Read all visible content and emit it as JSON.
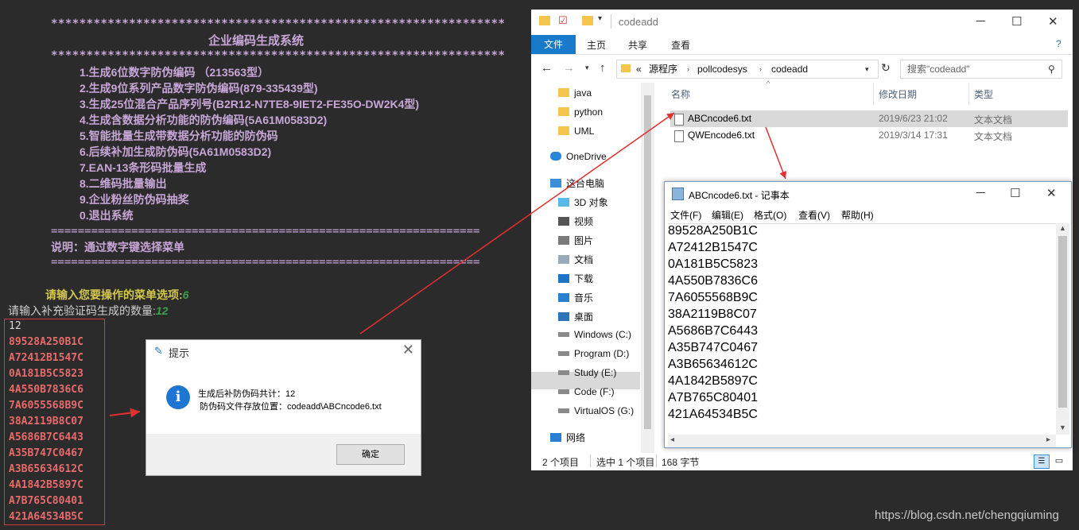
{
  "console": {
    "stars": "****************************************************************",
    "title": "企业编码生成系统",
    "menu": [
      "1.生成6位数字防伪编码 （213563型）",
      "2.生成9位系列产品数字防伪编码(879-335439型)",
      "3.生成25位混合产品序列号(B2R12-N7TE8-9IET2-FE35O-DW2K4型)",
      "4.生成含数据分析功能的防伪编码(5A61M0583D2)",
      "5.智能批量生成带数据分析功能的防伪码",
      "6.后续补加生成防伪码(5A61M0583D2)",
      "7.EAN-13条形码批量生成",
      "8.二维码批量输出",
      "9.企业粉丝防伪码抽奖",
      "0.退出系统"
    ],
    "equals": "================================================================",
    "note": "说明：通过数字键选择菜单",
    "prompt_label": "请输入您要操作的菜单选项:",
    "prompt_value": "6",
    "count_label": "请输入补充验证码生成的数量:",
    "count_value": "12",
    "output_first": "12",
    "codes": [
      "89528A250B1C",
      "A72412B1547C",
      "0A181B5C5823",
      "4A550B7836C6",
      "7A6055568B9C",
      "38A2119B8C07",
      "A5686B7C6443",
      "A35B747C0467",
      "A3B65634612C",
      "4A1842B5897C",
      "A7B765C80401",
      "421A64534B5C"
    ]
  },
  "dialog": {
    "title": "提示",
    "line1": "生成后补防伪码共计：12",
    "line2": "防伪码文件存放位置：codeadd\\ABCncode6.txt",
    "ok": "确定"
  },
  "explorer": {
    "title": "codeadd",
    "tabs": [
      "文件",
      "主页",
      "共享",
      "查看"
    ],
    "path": [
      "«",
      "源程序",
      "pollcodesys",
      "codeadd"
    ],
    "search_placeholder": "搜索\"codeadd\"",
    "nav": [
      {
        "label": "java"
      },
      {
        "label": "python"
      },
      {
        "label": "UML"
      },
      {
        "label": "OneDrive"
      },
      {
        "label": "这台电脑"
      },
      {
        "label": "3D 对象"
      },
      {
        "label": "视频"
      },
      {
        "label": "图片"
      },
      {
        "label": "文档"
      },
      {
        "label": "下载"
      },
      {
        "label": "音乐"
      },
      {
        "label": "桌面"
      },
      {
        "label": "Windows (C:)"
      },
      {
        "label": "Program (D:)"
      },
      {
        "label": "Study (E:)"
      },
      {
        "label": "Code (F:)"
      },
      {
        "label": "VirtualOS (G:)"
      },
      {
        "label": "网络"
      }
    ],
    "columns": [
      "名称",
      "修改日期",
      "类型"
    ],
    "files": [
      {
        "name": "ABCncode6.txt",
        "date": "2019/6/23 21:02",
        "type": "文本文档"
      },
      {
        "name": "QWEncode6.txt",
        "date": "2019/3/14 17:31",
        "type": "文本文档"
      }
    ],
    "status_items": "2 个项目",
    "status_selected": "选中 1 个项目",
    "status_size": "168 字节"
  },
  "notepad": {
    "title": "ABCncode6.txt - 记事本",
    "menu": [
      "文件(F)",
      "编辑(E)",
      "格式(O)",
      "查看(V)",
      "帮助(H)"
    ],
    "lines": [
      "89528A250B1C",
      "A72412B1547C",
      "0A181B5C5823",
      "4A550B7836C6",
      "7A6055568B9C",
      "38A2119B8C07",
      "A5686B7C6443",
      "A35B747C0467",
      "A3B65634612C",
      "4A1842B5897C",
      "A7B765C80401",
      "421A64534B5C"
    ]
  },
  "watermark": "https://blog.csdn.net/chengqiuming",
  "colors": {
    "console_bg": "#2b2b2b",
    "menu_text": "#c8a6d8",
    "code_red": "#e86a6a",
    "accent_blue": "#1979ca",
    "arrow_red": "#e03030"
  }
}
